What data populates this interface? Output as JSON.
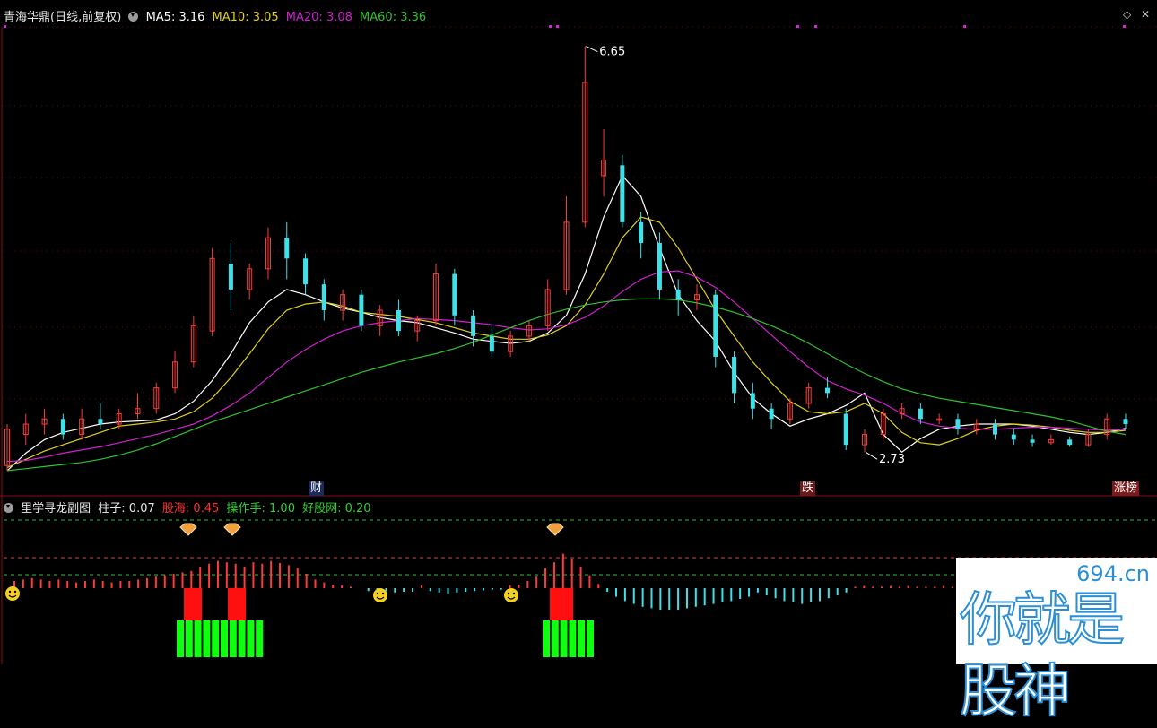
{
  "header": {
    "stock_title": "青海华鼎(日线,前复权)",
    "ma5": "MA5: 3.16",
    "ma10": "MA10: 3.05",
    "ma20": "MA20: 3.08",
    "ma60": "MA60: 3.36"
  },
  "indicator_header": {
    "name": "里学寻龙副图",
    "zhuzi": "柱子: 0.07",
    "guhai": "股海: 0.45",
    "caozuoshou": "操作手: 1.00",
    "haogu": "好股网: 0.20"
  },
  "markers": {
    "high_label": "6.65",
    "low_label": "2.73",
    "cai_tag": "财",
    "die_tag": "跌",
    "zhangbang_tag": "涨榜"
  },
  "watermark": {
    "url": "694.cn",
    "text": "你就是股神"
  },
  "colors": {
    "up": "#ff3a3a",
    "down": "#3fe0e8",
    "ma5": "#ffffff",
    "ma10": "#e0d020",
    "ma20": "#d020d0",
    "ma60": "#30c030",
    "bar_red": "#ff1010",
    "bar_green": "#10ff10"
  },
  "chart_data": [
    {
      "type": "candlestick",
      "title": "青海华鼎(日线,前复权)",
      "ylim": [
        2.55,
        6.75
      ],
      "high": 6.65,
      "low": 2.73,
      "series": [
        {
          "name": "MA5",
          "values": [
            2.55,
            2.72,
            2.85,
            2.92,
            2.96,
            3.0,
            3.02,
            3.03,
            3.04,
            3.1,
            3.22,
            3.42,
            3.68,
            3.98,
            4.18,
            4.3,
            4.25,
            4.18,
            4.12,
            4.08,
            4.03,
            4.0,
            3.98,
            3.93,
            3.88,
            3.82,
            3.8,
            3.78,
            3.8,
            3.88,
            4.05,
            4.45,
            5.0,
            5.4,
            5.2,
            4.7,
            4.25,
            4.0,
            3.8,
            3.5,
            3.25,
            3.1,
            2.98,
            3.05,
            3.1,
            3.18,
            3.3,
            2.9,
            2.73,
            2.86,
            2.95,
            2.98,
            3.0,
            3.0,
            3.0,
            2.98,
            2.95,
            2.92,
            2.9,
            2.92,
            2.96
          ]
        },
        {
          "name": "MA10",
          "values": [
            2.58,
            2.66,
            2.74,
            2.8,
            2.86,
            2.92,
            2.98,
            3.0,
            3.02,
            3.05,
            3.12,
            3.25,
            3.45,
            3.68,
            3.92,
            4.1,
            4.16,
            4.18,
            4.14,
            4.08,
            4.06,
            4.04,
            4.01,
            3.98,
            3.93,
            3.88,
            3.85,
            3.82,
            3.82,
            3.86,
            3.95,
            4.15,
            4.45,
            4.8,
            5.0,
            4.95,
            4.7,
            4.4,
            4.1,
            3.85,
            3.6,
            3.4,
            3.22,
            3.12,
            3.1,
            3.12,
            3.2,
            3.1,
            2.92,
            2.82,
            2.8,
            2.86,
            2.94,
            2.98,
            3.0,
            2.99,
            2.97,
            2.94,
            2.92,
            2.92,
            2.94
          ]
        },
        {
          "name": "MA20",
          "values": [
            2.64,
            2.65,
            2.68,
            2.72,
            2.75,
            2.78,
            2.82,
            2.86,
            2.9,
            2.95,
            3.0,
            3.08,
            3.18,
            3.3,
            3.45,
            3.6,
            3.72,
            3.82,
            3.9,
            3.95,
            3.98,
            4.0,
            4.02,
            4.01,
            4.0,
            3.98,
            3.96,
            3.93,
            3.91,
            3.92,
            3.96,
            4.03,
            4.14,
            4.28,
            4.4,
            4.47,
            4.48,
            4.42,
            4.32,
            4.18,
            4.02,
            3.86,
            3.7,
            3.55,
            3.42,
            3.34,
            3.28,
            3.2,
            3.1,
            3.02,
            2.98,
            2.96,
            2.95,
            2.95,
            2.96,
            2.97,
            2.97,
            2.96,
            2.95,
            2.94,
            2.95
          ]
        },
        {
          "name": "MA60",
          "values": [
            2.55,
            2.57,
            2.59,
            2.61,
            2.63,
            2.66,
            2.7,
            2.75,
            2.81,
            2.88,
            2.95,
            3.02,
            3.08,
            3.14,
            3.2,
            3.26,
            3.32,
            3.38,
            3.44,
            3.5,
            3.55,
            3.6,
            3.64,
            3.68,
            3.73,
            3.79,
            3.86,
            3.93,
            4.0,
            4.06,
            4.11,
            4.15,
            4.18,
            4.2,
            4.21,
            4.21,
            4.2,
            4.17,
            4.13,
            4.08,
            4.02,
            3.95,
            3.87,
            3.78,
            3.68,
            3.58,
            3.49,
            3.41,
            3.34,
            3.29,
            3.25,
            3.22,
            3.19,
            3.16,
            3.13,
            3.1,
            3.07,
            3.03,
            2.98,
            2.93,
            2.9
          ]
        }
      ],
      "candles": [
        [
          2.6,
          2.95,
          2.55,
          3.0
        ],
        [
          2.9,
          3.0,
          2.8,
          3.1
        ],
        [
          3.0,
          3.05,
          2.9,
          3.15
        ],
        [
          3.05,
          2.9,
          2.85,
          3.1
        ],
        [
          2.9,
          3.05,
          2.85,
          3.15
        ],
        [
          3.05,
          3.0,
          2.95,
          3.2
        ],
        [
          3.0,
          3.1,
          2.95,
          3.15
        ],
        [
          3.1,
          3.15,
          3.05,
          3.3
        ],
        [
          3.15,
          3.35,
          3.1,
          3.4
        ],
        [
          3.35,
          3.6,
          3.3,
          3.7
        ],
        [
          3.6,
          3.95,
          3.55,
          4.05
        ],
        [
          3.9,
          4.6,
          3.85,
          4.7
        ],
        [
          4.55,
          4.3,
          4.1,
          4.75
        ],
        [
          4.3,
          4.5,
          4.2,
          4.55
        ],
        [
          4.5,
          4.8,
          4.4,
          4.9
        ],
        [
          4.8,
          4.6,
          4.4,
          4.95
        ],
        [
          4.6,
          4.35,
          4.25,
          4.65
        ],
        [
          4.35,
          4.1,
          4.0,
          4.4
        ],
        [
          4.1,
          4.25,
          4.0,
          4.3
        ],
        [
          4.25,
          3.95,
          3.9,
          4.3
        ],
        [
          3.95,
          4.1,
          3.85,
          4.15
        ],
        [
          4.1,
          3.9,
          3.85,
          4.2
        ],
        [
          3.9,
          4.0,
          3.8,
          4.05
        ],
        [
          4.0,
          4.45,
          3.95,
          4.55
        ],
        [
          4.45,
          4.05,
          3.95,
          4.5
        ],
        [
          4.05,
          3.85,
          3.75,
          4.1
        ],
        [
          3.85,
          3.7,
          3.65,
          3.95
        ],
        [
          3.7,
          3.85,
          3.65,
          3.9
        ],
        [
          3.85,
          3.95,
          3.8,
          4.0
        ],
        [
          3.95,
          4.3,
          3.9,
          4.4
        ],
        [
          4.3,
          4.95,
          4.25,
          5.2
        ],
        [
          4.95,
          6.3,
          4.9,
          6.65
        ],
        [
          5.4,
          5.55,
          5.2,
          5.85
        ],
        [
          5.5,
          4.95,
          4.9,
          5.6
        ],
        [
          4.95,
          4.75,
          4.6,
          5.05
        ],
        [
          4.75,
          4.3,
          4.2,
          4.85
        ],
        [
          4.3,
          4.2,
          4.05,
          4.4
        ],
        [
          4.2,
          4.25,
          4.1,
          4.35
        ],
        [
          4.25,
          3.65,
          3.55,
          4.3
        ],
        [
          3.65,
          3.3,
          3.2,
          3.7
        ],
        [
          3.3,
          3.15,
          3.05,
          3.4
        ],
        [
          3.15,
          3.05,
          2.95,
          3.2
        ],
        [
          3.05,
          3.2,
          3.0,
          3.25
        ],
        [
          3.2,
          3.35,
          3.15,
          3.4
        ],
        [
          3.35,
          3.3,
          3.25,
          3.45
        ],
        [
          3.1,
          2.8,
          2.75,
          3.15
        ],
        [
          2.8,
          2.9,
          2.73,
          2.95
        ],
        [
          2.9,
          3.1,
          2.85,
          3.15
        ],
        [
          3.1,
          3.15,
          3.05,
          3.2
        ],
        [
          3.15,
          3.05,
          3.0,
          3.2
        ],
        [
          3.05,
          3.05,
          3.0,
          3.1
        ],
        [
          3.05,
          2.95,
          2.9,
          3.1
        ],
        [
          2.95,
          3.0,
          2.9,
          3.05
        ],
        [
          3.0,
          2.9,
          2.85,
          3.05
        ],
        [
          2.9,
          2.85,
          2.8,
          2.95
        ],
        [
          2.85,
          2.82,
          2.78,
          2.9
        ],
        [
          2.82,
          2.85,
          2.8,
          2.9
        ],
        [
          2.85,
          2.8,
          2.78,
          2.88
        ],
        [
          2.8,
          2.9,
          2.78,
          2.95
        ],
        [
          2.9,
          3.05,
          2.85,
          3.1
        ],
        [
          3.05,
          3.0,
          2.95,
          3.1
        ]
      ]
    },
    {
      "type": "bar",
      "title": "里学寻龙副图",
      "series": [
        {
          "name": "柱子",
          "values": [
            0.1,
            0.12,
            0.14,
            0.12,
            0.1,
            0.12,
            0.1,
            0.08,
            0.1,
            0.12,
            0.1,
            0.08,
            0.1,
            0.1,
            0.12,
            0.14,
            0.16,
            0.18,
            0.2,
            0.22,
            0.24,
            0.3,
            0.34,
            0.38,
            0.36,
            0.34,
            0.3,
            0.36,
            0.34,
            0.38,
            0.35,
            0.32,
            0.28,
            0.2,
            0.12,
            0.08,
            0.05,
            0.04,
            0.02,
            0.0,
            -0.04,
            -0.05,
            -0.04,
            -0.06,
            -0.05,
            -0.05,
            0.04,
            -0.04,
            -0.06,
            -0.08,
            -0.06,
            -0.05,
            -0.04,
            -0.03,
            -0.02,
            -0.02,
            0.04,
            0.05,
            0.1,
            0.16,
            0.28,
            0.36,
            0.48,
            0.4,
            0.3,
            0.18,
            0.06,
            -0.05,
            -0.12,
            -0.18,
            -0.22,
            -0.26,
            -0.28,
            -0.3,
            -0.3,
            -0.3,
            -0.28,
            -0.26,
            -0.24,
            -0.22,
            -0.2,
            -0.18,
            -0.15,
            -0.12,
            -0.06,
            -0.1,
            -0.14,
            -0.18,
            -0.2,
            -0.22,
            -0.2,
            -0.18,
            -0.14,
            -0.1,
            -0.06,
            0.02,
            0.03,
            0.02,
            0.02,
            0.03,
            0.02,
            0.03,
            0.02,
            0.02,
            0.02,
            0.03,
            0.02
          ]
        }
      ]
    }
  ]
}
